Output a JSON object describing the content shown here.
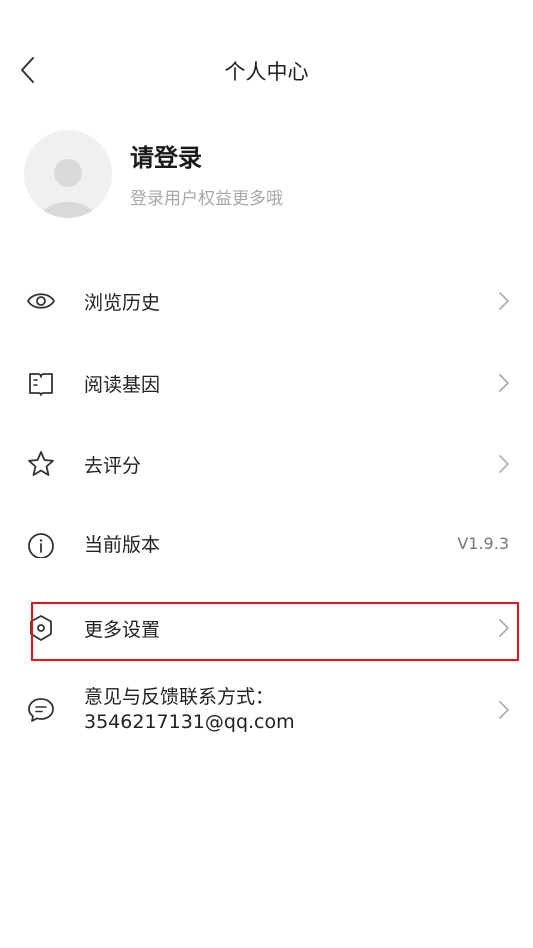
{
  "header": {
    "title": "个人中心",
    "back_icon": "chevron-left-icon"
  },
  "profile": {
    "name": "请登录",
    "subtitle": "登录用户权益更多哦",
    "avatar_icon": "default-avatar-icon"
  },
  "menu": {
    "items": [
      {
        "label": "浏览历史",
        "icon": "eye-icon",
        "trailing": "chevron-right-icon"
      },
      {
        "label": "阅读基因",
        "icon": "book-icon",
        "trailing": "chevron-right-icon"
      },
      {
        "label": "去评分",
        "icon": "star-icon",
        "trailing": "chevron-right-icon"
      },
      {
        "label": "当前版本",
        "icon": "info-icon",
        "value": "V1.9.3"
      },
      {
        "label": "更多设置",
        "icon": "settings-hexagon-icon",
        "trailing": "chevron-right-icon",
        "highlighted": true
      },
      {
        "label": "意见与反馈联系方式：3546217131@qq.com",
        "icon": "chat-bubble-icon",
        "trailing": "chevron-right-icon"
      }
    ]
  },
  "colors": {
    "highlight_border": "#e0151b",
    "text_primary": "#222222",
    "text_secondary": "#a8a8a8",
    "icon_stroke": "#333333",
    "chevron": "#b0b0b0"
  }
}
